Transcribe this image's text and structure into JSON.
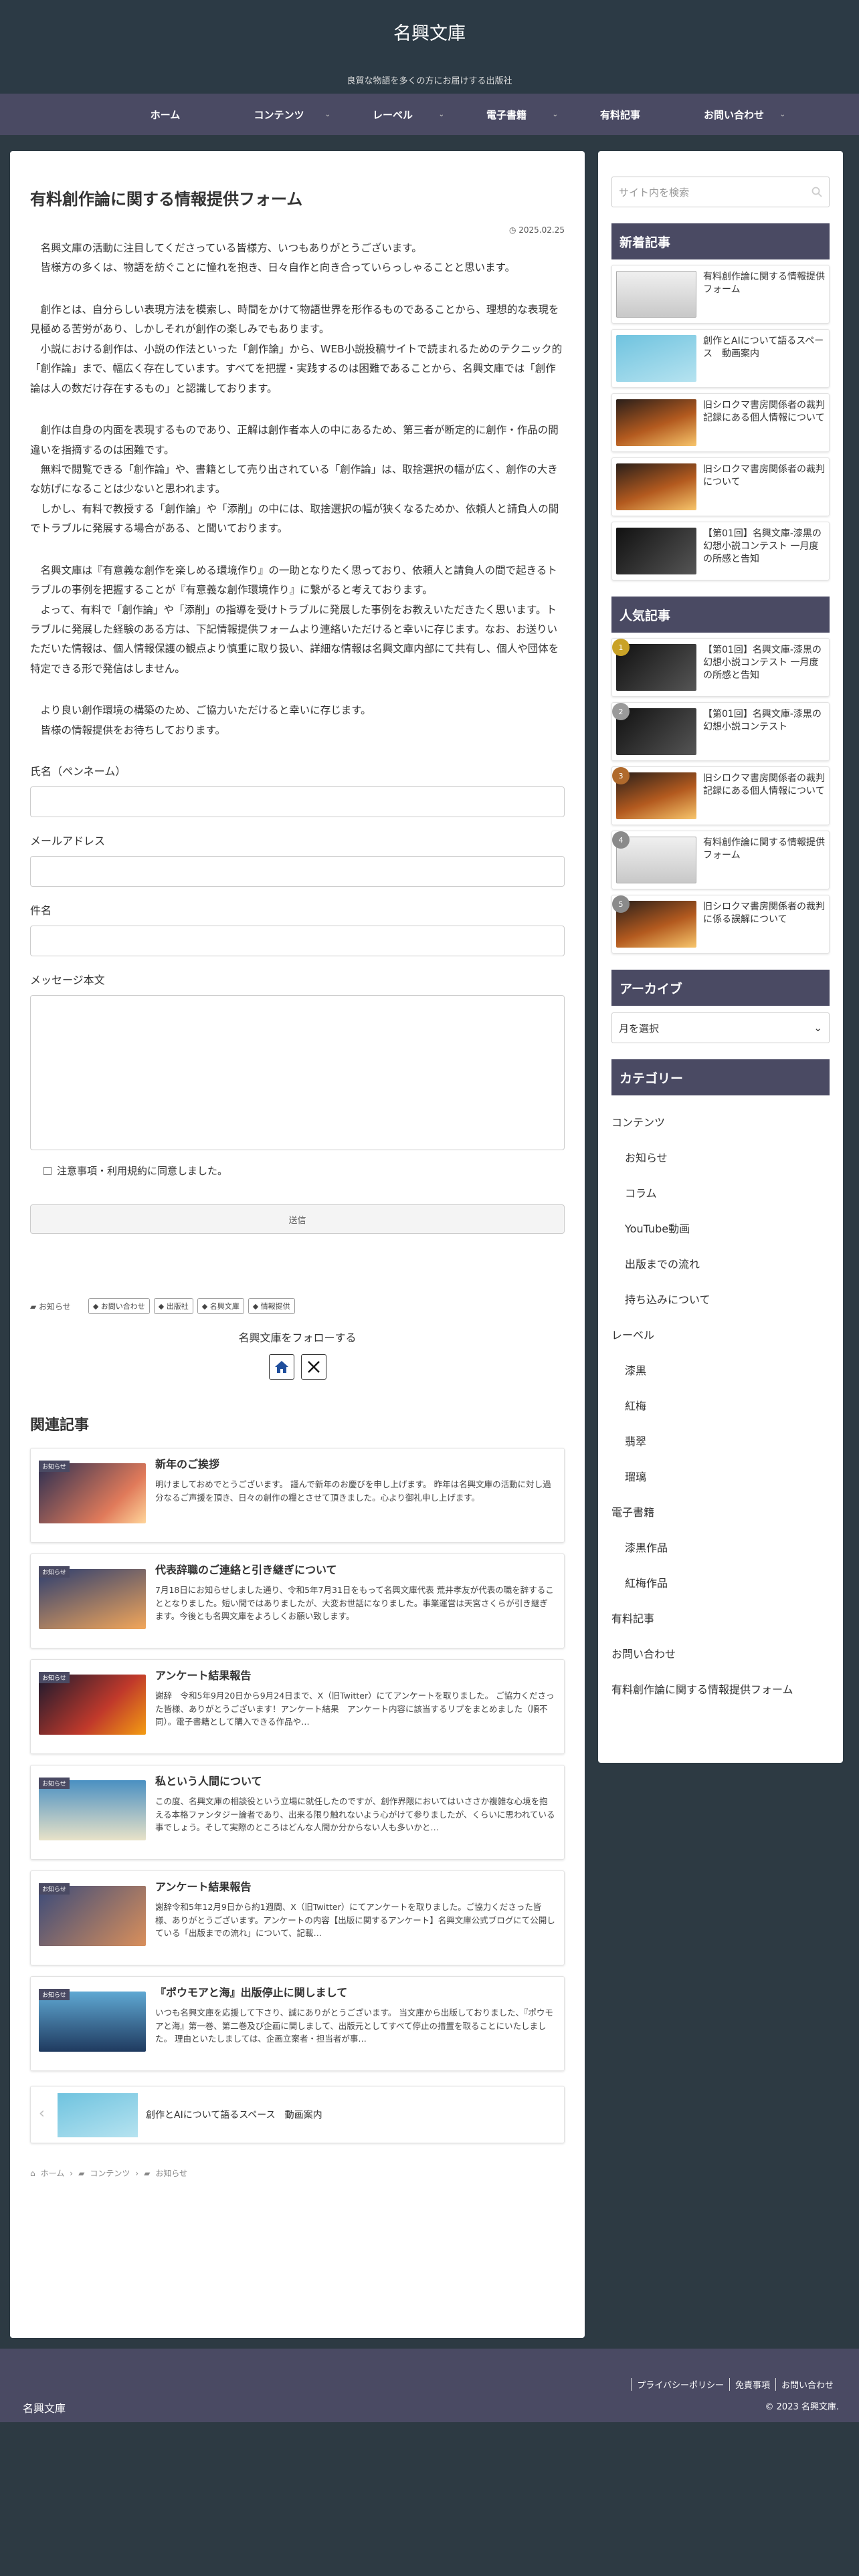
{
  "header": {
    "site_title": "名興文庫",
    "tagline": "良質な物語を多くの方にお届けする出版社"
  },
  "nav": [
    {
      "label": "ホーム",
      "dropdown": false
    },
    {
      "label": "コンテンツ",
      "dropdown": true
    },
    {
      "label": "レーベル",
      "dropdown": true
    },
    {
      "label": "電子書籍",
      "dropdown": true
    },
    {
      "label": "有料記事",
      "dropdown": false
    },
    {
      "label": "お問い合わせ",
      "dropdown": true
    }
  ],
  "post": {
    "title": "有料創作論に関する情報提供フォーム",
    "date": "2025.02.25",
    "paragraphs": [
      "　名興文庫の活動に注目してくださっている皆様方、いつもありがとうございます。\n　皆様方の多くは、物語を紡ぐことに憧れを抱き、日々自作と向き合っていらっしゃることと思います。",
      "　創作とは、自分らしい表現方法を模索し、時間をかけて物語世界を形作るものであることから、理想的な表現を見極める苦労があり、しかしそれが創作の楽しみでもあります。\n　小説における創作は、小説の作法といった「創作論」から、WEB小説投稿サイトで読まれるためのテクニック的「創作論」まで、幅広く存在しています。すべてを把握・実践するのは困難であることから、名興文庫では「創作論は人の数だけ存在するもの」と認識しております。",
      "　創作は自身の内面を表現するものであり、正解は創作者本人の中にあるため、第三者が断定的に創作・作品の間違いを指摘するのは困難です。\n　無料で閲覧できる「創作論」や、書籍として売り出されている「創作論」は、取捨選択の幅が広く、創作の大きな妨げになることは少ないと思われます。\n　しかし、有料で教授する「創作論」や「添削」の中には、取捨選択の幅が狭くなるためか、依頼人と請負人の間でトラブルに発展する場合がある、と聞いております。",
      "　名興文庫は『有意義な創作を楽しめる環境作り』の一助となりたく思っており、依頼人と請負人の間で起きるトラブルの事例を把握することが『有意義な創作環境作り』に繋がると考えております。\n　よって、有料で「創作論」や「添削」の指導を受けトラブルに発展した事例をお教えいただきたく思います。トラブルに発展した経験のある方は、下記情報提供フォームより連絡いただけると幸いに存じます。なお、お送りいただいた情報は、個人情報保護の観点より慎重に取り扱い、詳細な情報は名興文庫内部にて共有し、個人や団体を特定できる形で発信はしません。",
      "　より良い創作環境の構築のため、ご協力いただけると幸いに存じます。\n　皆様の情報提供をお待ちしております。"
    ]
  },
  "form": {
    "name_label": "氏名（ペンネーム）",
    "email_label": "メールアドレス",
    "subject_label": "件名",
    "message_label": "メッセージ本文",
    "agree_label": "注意事項・利用規約に同意しました。",
    "submit_label": "送信"
  },
  "meta": {
    "category": "お知らせ",
    "tags": [
      "お問い合わせ",
      "出版社",
      "名興文庫",
      "情報提供"
    ]
  },
  "follow": {
    "label": "名興文庫をフォローする",
    "icons": [
      "home-icon",
      "x-icon"
    ]
  },
  "related": {
    "heading": "関連記事",
    "badge": "お知らせ",
    "items": [
      {
        "title": "新年のご挨拶",
        "excerpt": "明けましておめでとうございます。 謹んで新年のお慶びを申し上げます。 昨年は名興文庫の活動に対し過分なるご声援を頂き、日々の創作の糧とさせて頂きました。心より御礼申し上げます。",
        "thumb": "t1"
      },
      {
        "title": "代表辞職のご連絡と引き継ぎについて",
        "excerpt": "7月18日にお知らせしました通り、令和5年7月31日をもって名興文庫代表 荒井孝友が代表の職を辞することとなりました。短い間ではありましたが、大変お世話になりました。事業運営は天宮さくらが引き継ぎます。今後とも名興文庫をよろしくお願い致します。",
        "thumb": "t2"
      },
      {
        "title": "アンケート結果報告",
        "excerpt": "謝辞　令和5年9月20日から9月24日まで、X（旧Twitter）にてアンケートを取りました。 ご協力くださった皆様、ありがとうございます！アンケート結果　アンケート内容に該当するリプをまとめました（順不同）。電子書籍として購入できる作品や…",
        "thumb": "t3"
      },
      {
        "title": "私という人間について",
        "excerpt": "この度、名興文庫の相談役という立場に就任したのですが、創作界隈においてはいささか複雑な心境を抱える本格ファンタジー論者であり、出来る限り触れないよう心がけて参りましたが、くらいに思われている事でしょう。そして実際のところはどんな人間か分からない人も多いかと…",
        "thumb": "t4"
      },
      {
        "title": "アンケート結果報告",
        "excerpt": "謝辞令和5年12月9日から約1週間、X（旧Twitter）にてアンケートを取りました。ご協力くださった皆様、ありがとうございます。アンケートの内容【出版に関するアンケート】名興文庫公式ブログにて公開している「出版までの流れ」について、記載…",
        "thumb": "t5"
      },
      {
        "title": "『ポウモアと海』出版停止に関しまして",
        "excerpt": "いつも名興文庫を応援して下さり、誠にありがとうございます。 当文庫から出版しておりました、『ポウモアと海』第一巻、第二巻及び企画に関しまして、出版元としてすべて停止の措置を取ることにいたしました。 理由といたしましては、企画立案者・担当者が事…",
        "thumb": "t6"
      }
    ]
  },
  "prev": {
    "title": "創作とAIについて語るスペース　動画案内"
  },
  "breadcrumb": [
    "ホーム",
    "コンテンツ",
    "お知らせ"
  ],
  "sidebar": {
    "search_placeholder": "サイト内を検索",
    "new_heading": "新着記事",
    "new_items": [
      {
        "title": "有料創作論に関する情報提供フォーム",
        "thumb": "tw"
      },
      {
        "title": "創作とAIについて語るスペース　動画案内",
        "thumb": "ty"
      },
      {
        "title": "旧シロクマ書房関係者の裁判記録にある個人情報について",
        "thumb": "to"
      },
      {
        "title": "旧シロクマ書房関係者の裁判について",
        "thumb": "to"
      },
      {
        "title": "【第01回】名興文庫-漆黒の幻想小説コンテスト 一月度の所感と告知",
        "thumb": "tb"
      }
    ],
    "popular_heading": "人気記事",
    "popular_items": [
      {
        "rank": "1",
        "rank_color": "#c9a227",
        "title": "【第01回】名興文庫-漆黒の幻想小説コンテスト 一月度の所感と告知",
        "thumb": "tb"
      },
      {
        "rank": "2",
        "rank_color": "#9a9a9a",
        "title": "【第01回】名興文庫-漆黒の幻想小説コンテスト",
        "thumb": "tb"
      },
      {
        "rank": "3",
        "rank_color": "#b06a2c",
        "title": "旧シロクマ書房関係者の裁判記録にある個人情報について",
        "thumb": "to"
      },
      {
        "rank": "4",
        "rank_color": "#8a8a8a",
        "title": "有料創作論に関する情報提供フォーム",
        "thumb": "tw"
      },
      {
        "rank": "5",
        "rank_color": "#8a8a8a",
        "title": "旧シロクマ書房関係者の裁判に係る誤解について",
        "thumb": "to"
      }
    ],
    "archive_heading": "アーカイブ",
    "archive_select": "月を選択",
    "category_heading": "カテゴリー",
    "categories": [
      {
        "label": "コンテンツ",
        "child": false
      },
      {
        "label": "お知らせ",
        "child": true
      },
      {
        "label": "コラム",
        "child": true
      },
      {
        "label": "YouTube動画",
        "child": true
      },
      {
        "label": "出版までの流れ",
        "child": true
      },
      {
        "label": "持ち込みについて",
        "child": true
      },
      {
        "label": "レーベル",
        "child": false
      },
      {
        "label": "漆黒",
        "child": true
      },
      {
        "label": "紅梅",
        "child": true
      },
      {
        "label": "翡翠",
        "child": true
      },
      {
        "label": "瑠璃",
        "child": true
      },
      {
        "label": "電子書籍",
        "child": false
      },
      {
        "label": "漆黒作品",
        "child": true
      },
      {
        "label": "紅梅作品",
        "child": true
      },
      {
        "label": "有料記事",
        "child": false
      },
      {
        "label": "お問い合わせ",
        "child": false
      },
      {
        "label": "有料創作論に関する情報提供フォーム",
        "child": false
      }
    ]
  },
  "footer": {
    "links": [
      "プライバシーポリシー",
      "免責事項",
      "お問い合わせ"
    ],
    "name": "名興文庫",
    "copyright": "© 2023 名興文庫."
  }
}
